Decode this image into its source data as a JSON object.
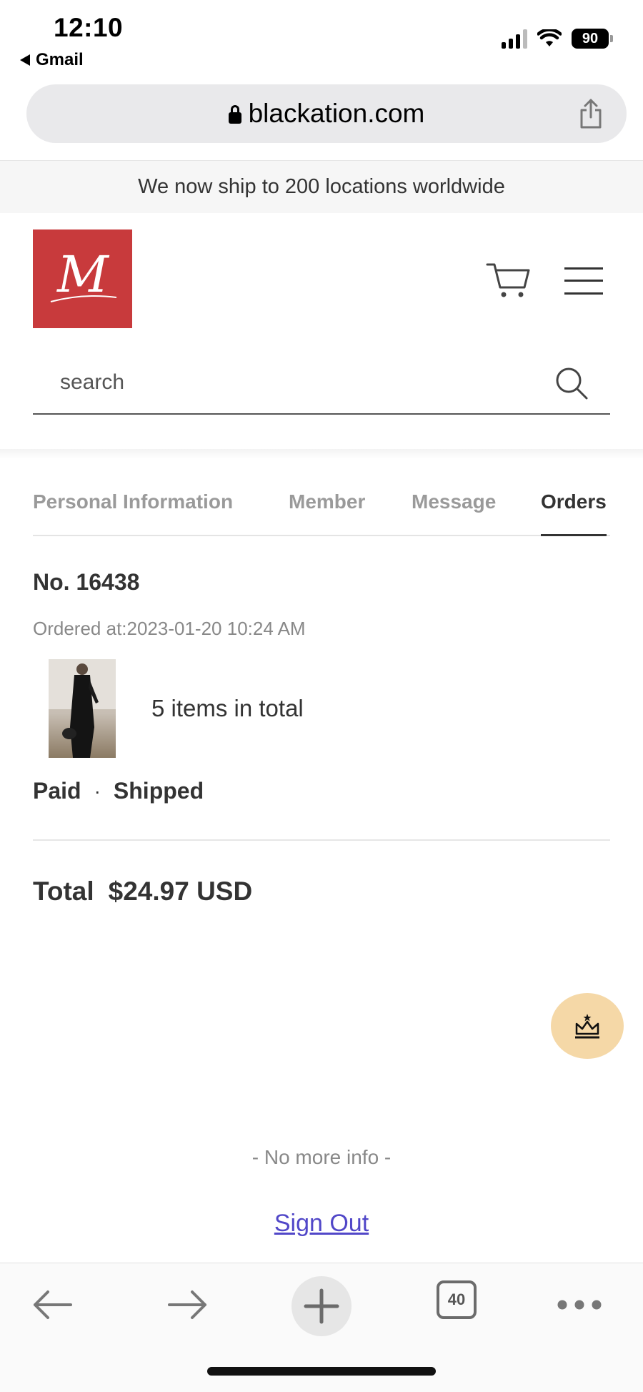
{
  "status_bar": {
    "time": "12:10",
    "back_app": "Gmail",
    "battery": "90"
  },
  "browser": {
    "url": "blackation.com",
    "tabs_count": "40"
  },
  "announcement": "We now ship to 200 locations worldwide",
  "header": {
    "logo_letter": "M",
    "search_placeholder": "search"
  },
  "tabs": [
    {
      "label": "Personal Information",
      "active": false
    },
    {
      "label": "Member",
      "active": false
    },
    {
      "label": "Message",
      "active": false
    },
    {
      "label": "Orders",
      "active": true
    }
  ],
  "order": {
    "number": "No. 16438",
    "ordered_at": "Ordered at:2023-01-20 10:24 AM",
    "items_text": "5 items in total",
    "payment_status": "Paid",
    "separator": "·",
    "shipping_status": "Shipped",
    "total_label": "Total",
    "total_value": "$24.97 USD"
  },
  "footer": {
    "no_more": "- No more info -",
    "sign_out": "Sign Out"
  },
  "colors": {
    "logo_bg": "#c83a3c",
    "crown_button_bg": "#f5d8a7",
    "sign_out_link": "#5147c8"
  }
}
